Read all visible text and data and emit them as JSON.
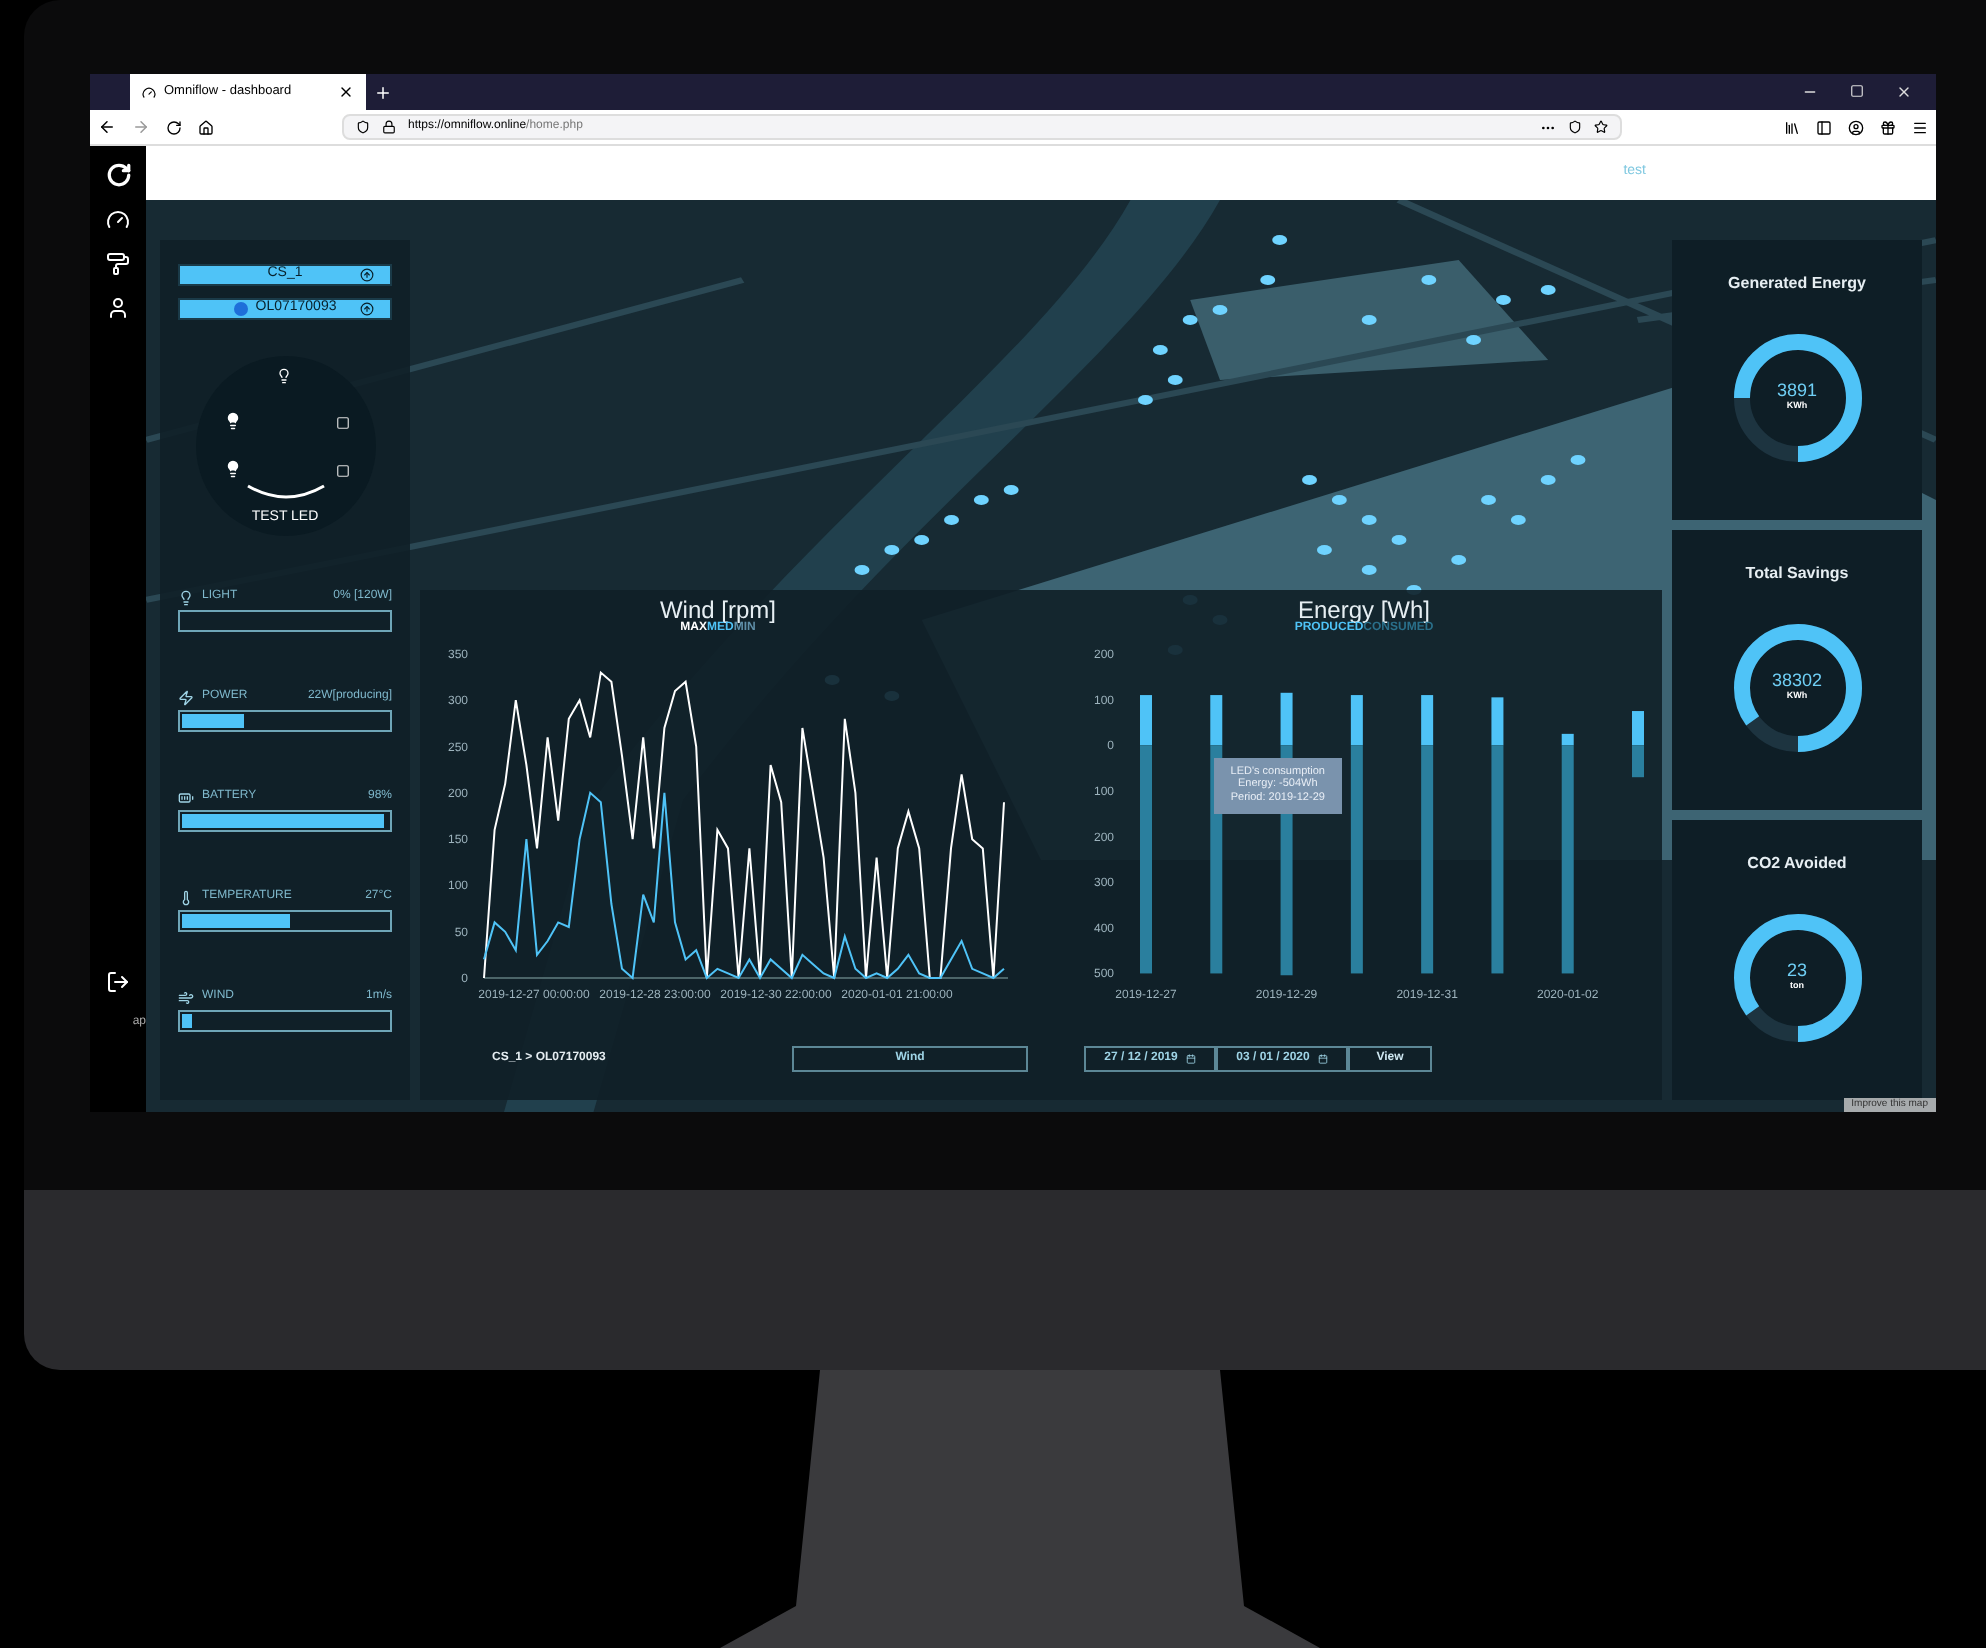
{
  "browser": {
    "tabs": [
      {
        "title": "Omniflow - dashboard",
        "selected": true
      }
    ],
    "url_host": "https://omniflow.online",
    "url_path": "/home.php"
  },
  "header": {
    "user_link": "test"
  },
  "selectors": [
    {
      "label": "CS_1",
      "dot": false
    },
    {
      "label": "OL07170093",
      "dot": true
    }
  ],
  "light_dial": {
    "label": "TEST LED"
  },
  "metrics": [
    {
      "kind": "light",
      "label": "LIGHT",
      "reading": "0% [120W]",
      "level": 0
    },
    {
      "kind": "power",
      "label": "POWER",
      "reading": "22W[producing]",
      "level": 0.3
    },
    {
      "kind": "battery",
      "label": "BATTERY",
      "reading": "98%",
      "level": 0.98
    },
    {
      "kind": "temperature",
      "label": "TEMPERATURE",
      "reading": "27°C",
      "level": 0.52
    },
    {
      "kind": "wind",
      "label": "WIND",
      "reading": "1m/s",
      "level": 0.05
    }
  ],
  "sidebar_fragment": "ap",
  "wind_chart": {
    "legend": [
      {
        "label": "MAX",
        "color": "#ffffff"
      },
      {
        "label": "MED",
        "color": "#4fc3f7"
      },
      {
        "label": "MIN",
        "color": "#5f8fa8"
      }
    ],
    "x_labels": [
      "2019-12-27 00:00:00",
      "2019-12-28 23:00:00",
      "2019-12-30 22:00:00",
      "2020-01-01 21:00:00"
    ],
    "chart_data": {
      "type": "line",
      "title": "Wind [rpm]",
      "ylim": [
        0,
        350
      ],
      "yticks": [
        0,
        50,
        100,
        150,
        200,
        250,
        300,
        350
      ],
      "series": [
        {
          "color": "#ffffff",
          "values": [
            0,
            160,
            210,
            300,
            230,
            140,
            260,
            170,
            280,
            300,
            260,
            330,
            320,
            240,
            150,
            260,
            140,
            270,
            310,
            320,
            250,
            0,
            160,
            140,
            0,
            140,
            0,
            230,
            190,
            0,
            270,
            200,
            130,
            0,
            280,
            200,
            0,
            130,
            0,
            140,
            180,
            140,
            0,
            0,
            140,
            220,
            150,
            140,
            0,
            190
          ]
        },
        {
          "color": "#4fc3f7",
          "values": [
            20,
            60,
            50,
            30,
            150,
            25,
            40,
            60,
            55,
            150,
            200,
            190,
            80,
            10,
            0,
            90,
            60,
            200,
            60,
            20,
            30,
            0,
            10,
            5,
            0,
            20,
            0,
            20,
            10,
            0,
            25,
            15,
            5,
            0,
            45,
            10,
            0,
            5,
            0,
            10,
            25,
            5,
            0,
            0,
            20,
            40,
            10,
            5,
            0,
            10
          ]
        }
      ]
    }
  },
  "energy_chart": {
    "legend": [
      {
        "label": "PRODUCED",
        "color": "#4fc3f7"
      },
      {
        "label": "CONSUMED",
        "color": "#2a6f8a"
      }
    ],
    "x_labels": [
      "2019-12-27",
      "2019-12-29",
      "2019-12-31",
      "2020-01-02"
    ],
    "chart_data": {
      "type": "bar",
      "title": "Energy [Wh]",
      "stacked": true,
      "ylim": [
        -510,
        200
      ],
      "yticks": [
        200,
        100,
        0,
        {
          "value": -100,
          "label": "100"
        },
        {
          "value": -200,
          "label": "200"
        },
        {
          "value": -300,
          "label": "300"
        },
        {
          "value": -400,
          "label": "400"
        },
        {
          "value": -500,
          "label": "500"
        }
      ],
      "series": [
        {
          "color": "#4fc3f7",
          "values": [
            110,
            110,
            115,
            110,
            110,
            105,
            25,
            75
          ]
        },
        {
          "color": "#2a7f9e",
          "values": [
            -500,
            -500,
            -504,
            -500,
            -500,
            -500,
            -500,
            -70
          ]
        }
      ]
    },
    "tooltip": {
      "lines": [
        "LED's consumption",
        "Energy: -504Wh",
        "Period: 2019-12-29"
      ]
    }
  },
  "controls": {
    "breadcrumb": "CS_1 > OL07170093",
    "variable": "Wind",
    "date_from": "27 / 12 / 2019",
    "date_to": "03 / 01 / 2020",
    "view_button": "View"
  },
  "cards": [
    {
      "title": "Generated Energy",
      "value": "3891",
      "unit": "KWh",
      "level": 0.75
    },
    {
      "title": "Total Savings",
      "value": "38302",
      "unit": "KWh",
      "level": 0.85
    },
    {
      "title": "CO2 Avoided",
      "value": "23",
      "unit": "ton",
      "level": 0.85
    }
  ],
  "map_attribution": "Improve this map"
}
